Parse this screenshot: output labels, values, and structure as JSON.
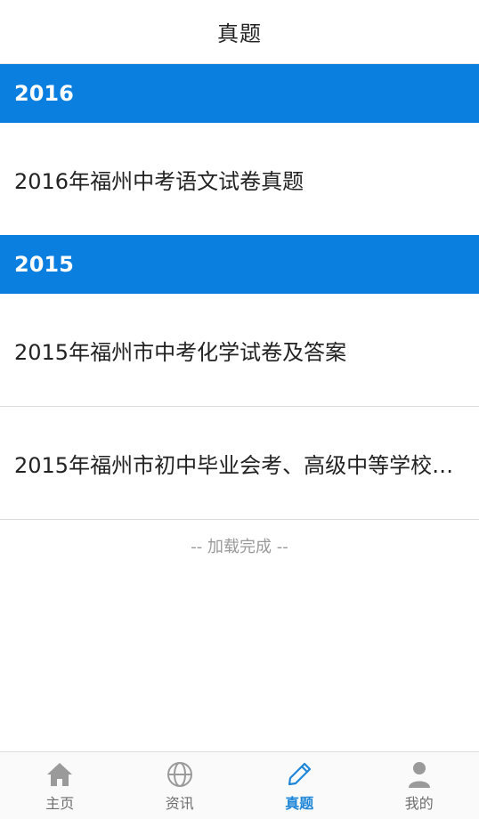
{
  "header": {
    "title": "真题"
  },
  "sections": [
    {
      "year": "2016",
      "items": [
        {
          "title": "2016年福州中考语文试卷真题"
        }
      ]
    },
    {
      "year": "2015",
      "items": [
        {
          "title": "2015年福州市中考化学试卷及答案"
        },
        {
          "title": "2015年福州市初中毕业会考、高级中等学校…"
        }
      ]
    }
  ],
  "load_status": "-- 加载完成 --",
  "tabs": [
    {
      "label": "主页",
      "icon": "home-icon",
      "active": false
    },
    {
      "label": "资讯",
      "icon": "globe-icon",
      "active": false
    },
    {
      "label": "真题",
      "icon": "pencil-icon",
      "active": true
    },
    {
      "label": "我的",
      "icon": "user-icon",
      "active": false
    }
  ],
  "colors": {
    "accent": "#0a7fe0",
    "tab_active": "#1e86d8",
    "tab_inactive": "#8a8a8a"
  }
}
